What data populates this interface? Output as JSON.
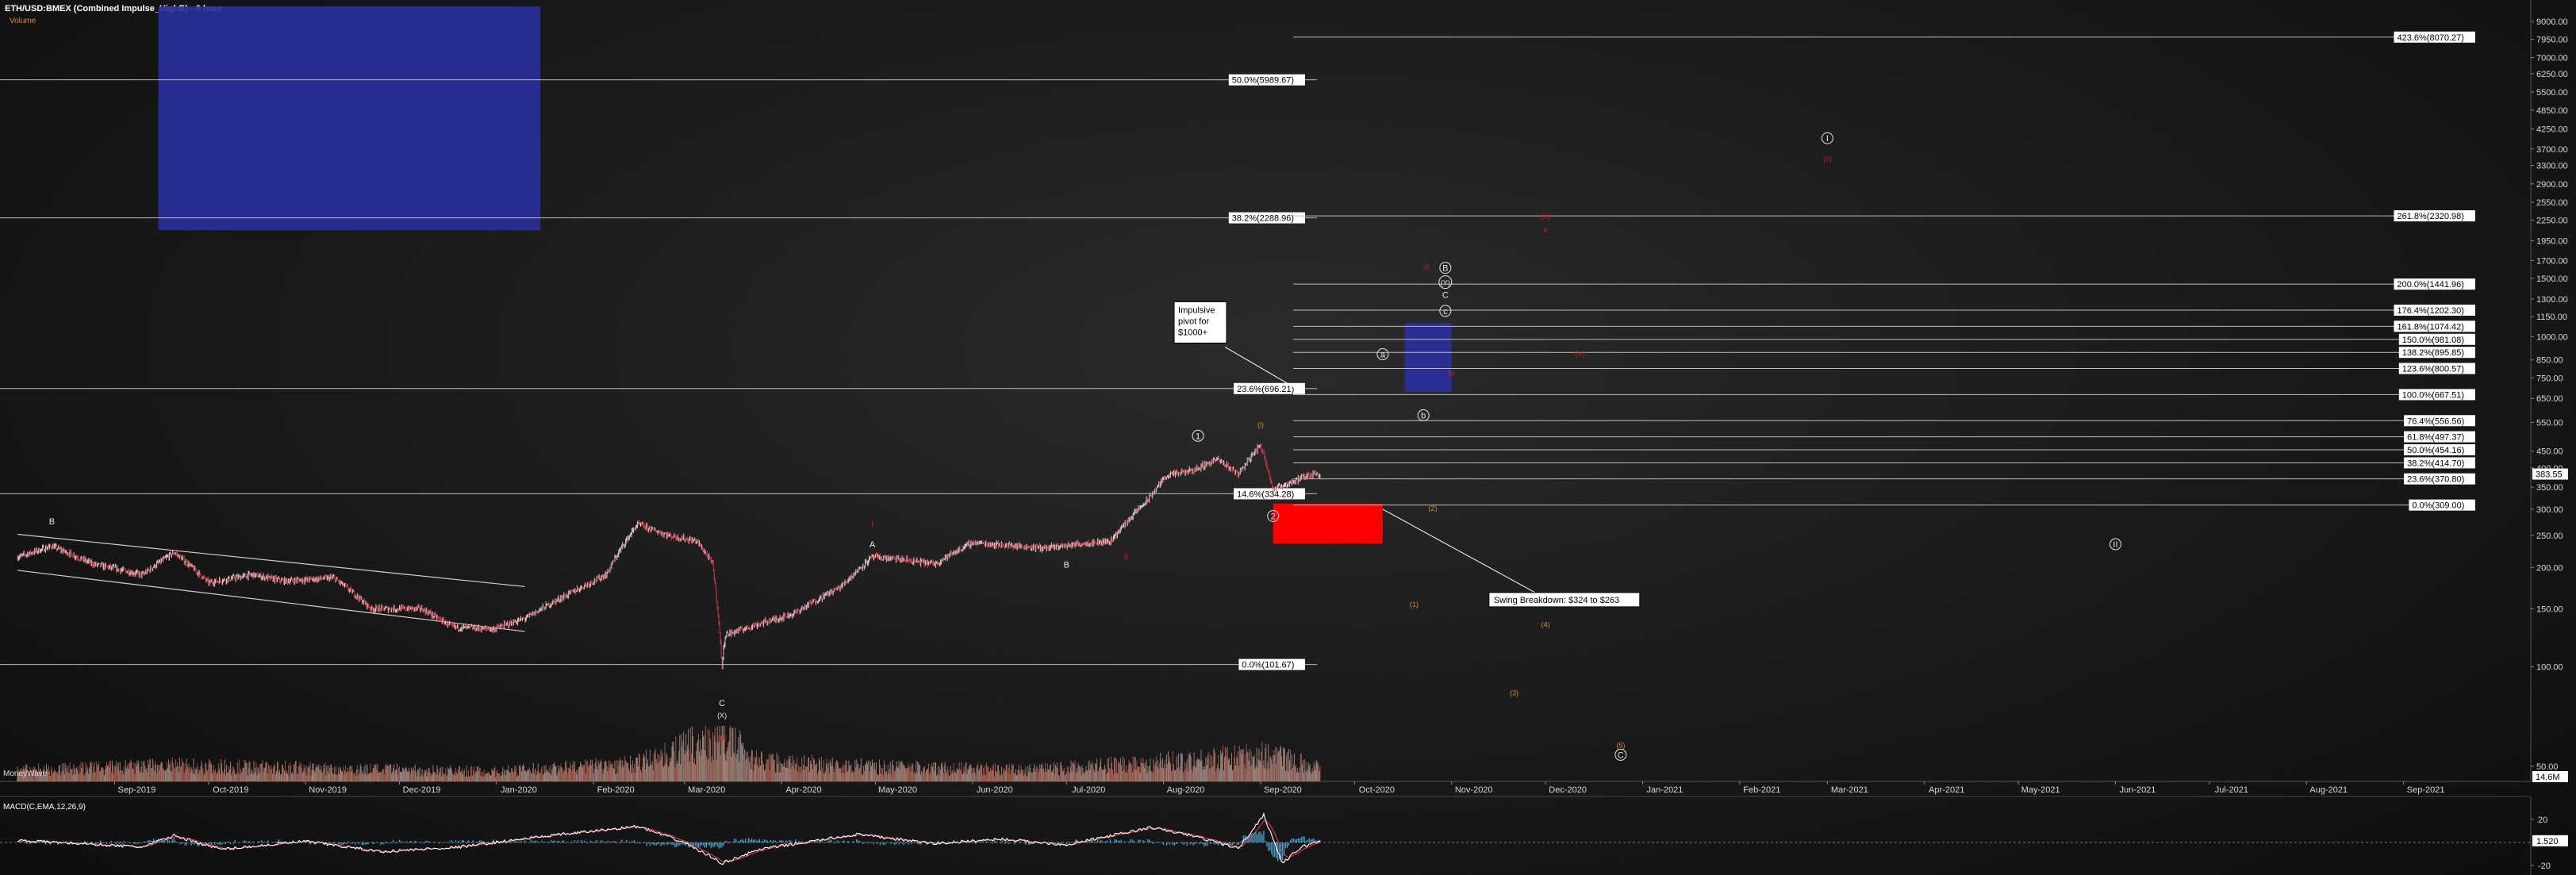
{
  "header": {
    "title": "ETH/USD:BMEX (Combined Impulse_HighB) - 6 hour",
    "subtitle": "Volume"
  },
  "colors": {
    "candle_up": "#d8d8d8",
    "candle_down": "#e0394a",
    "fib_line": "#bdbdbd",
    "blue_box": "#2a2f9c",
    "red_box": "#ff0000",
    "wave_orange": "#e08a1e",
    "wave_red": "#d01c1c",
    "wave_white": "#e6e6e6",
    "macd_line": "#ffffff",
    "signal_line": "#e0394a",
    "hist": "#4aa0c8"
  },
  "panels": {
    "volume_label": "MoneyWave",
    "volume_readout": "14.6M",
    "macd_label": "MACD(C,EMA,12,26,9)",
    "macd_readout": "1.520",
    "macd_ticks": [
      "20",
      "-20"
    ]
  },
  "chart_data": {
    "type": "candlestick",
    "symbol": "ETH/USD:BMEX",
    "scale": "log",
    "ylim": [
      45,
      10000
    ],
    "yticks": [
      "9000.00",
      "7950.00",
      "7000.00",
      "6250.00",
      "5500.00",
      "4850.00",
      "4250.00",
      "3700.00",
      "3300.00",
      "2900.00",
      "2550.00",
      "2250.00",
      "1950.00",
      "1700.00",
      "1500.00",
      "1300.00",
      "1150.00",
      "1000.00",
      "850.00",
      "750.00",
      "650.00",
      "550.00",
      "450.00",
      "400.00",
      "350.00",
      "300.00",
      "250.00",
      "200.00",
      "150.00",
      "100.00",
      "50.00"
    ],
    "xticks": [
      "Sep-2019",
      "Oct-2019",
      "Nov-2019",
      "Dec-2019",
      "Jan-2020",
      "Feb-2020",
      "Mar-2020",
      "Apr-2020",
      "May-2020",
      "Jun-2020",
      "Jul-2020",
      "Aug-2020",
      "Sep-2020",
      "Oct-2020",
      "Nov-2020",
      "Dec-2020",
      "Jan-2021",
      "Feb-2021",
      "Mar-2021",
      "Apr-2021",
      "May-2021",
      "Jun-2021",
      "Jul-2021",
      "Aug-2021",
      "Sep-2021"
    ],
    "last_price": "383.55",
    "price_path": [
      [
        "2019-08-01",
        215
      ],
      [
        "2019-08-12",
        232
      ],
      [
        "2019-08-25",
        205
      ],
      [
        "2019-09-10",
        190
      ],
      [
        "2019-09-20",
        222
      ],
      [
        "2019-10-01",
        180
      ],
      [
        "2019-10-15",
        190
      ],
      [
        "2019-10-25",
        182
      ],
      [
        "2019-11-10",
        186
      ],
      [
        "2019-11-22",
        150
      ],
      [
        "2019-12-08",
        150
      ],
      [
        "2019-12-18",
        132
      ],
      [
        "2019-12-31",
        130
      ],
      [
        "2020-01-10",
        140
      ],
      [
        "2020-01-25",
        168
      ],
      [
        "2020-02-05",
        190
      ],
      [
        "2020-02-15",
        270
      ],
      [
        "2020-02-25",
        250
      ],
      [
        "2020-03-05",
        240
      ],
      [
        "2020-03-10",
        205
      ],
      [
        "2020-03-13",
        100
      ],
      [
        "2020-03-14",
        125
      ],
      [
        "2020-03-25",
        135
      ],
      [
        "2020-04-05",
        145
      ],
      [
        "2020-04-20",
        175
      ],
      [
        "2020-04-30",
        215
      ],
      [
        "2020-05-08",
        212
      ],
      [
        "2020-05-20",
        205
      ],
      [
        "2020-06-01",
        238
      ],
      [
        "2020-06-15",
        232
      ],
      [
        "2020-06-25",
        229
      ],
      [
        "2020-07-05",
        236
      ],
      [
        "2020-07-15",
        240
      ],
      [
        "2020-07-27",
        320
      ],
      [
        "2020-08-02",
        380
      ],
      [
        "2020-08-10",
        392
      ],
      [
        "2020-08-18",
        425
      ],
      [
        "2020-08-25",
        385
      ],
      [
        "2020-09-01",
        470
      ],
      [
        "2020-09-05",
        345
      ],
      [
        "2020-09-10",
        360
      ],
      [
        "2020-09-18",
        385
      ],
      [
        "2020-09-20",
        383
      ]
    ],
    "volume_path": [
      [
        "2019-08-01",
        0.25
      ],
      [
        "2019-09-20",
        0.35
      ],
      [
        "2019-11-10",
        0.28
      ],
      [
        "2019-12-31",
        0.22
      ],
      [
        "2020-02-15",
        0.4
      ],
      [
        "2020-03-13",
        1.0
      ],
      [
        "2020-03-25",
        0.45
      ],
      [
        "2020-05-01",
        0.32
      ],
      [
        "2020-06-20",
        0.25
      ],
      [
        "2020-08-05",
        0.45
      ],
      [
        "2020-09-05",
        0.6
      ],
      [
        "2020-09-20",
        0.3
      ]
    ],
    "macd_path": [
      [
        "2019-08-01",
        2
      ],
      [
        "2019-09-10",
        -4
      ],
      [
        "2019-09-20",
        6
      ],
      [
        "2019-10-05",
        -6
      ],
      [
        "2019-11-01",
        1
      ],
      [
        "2019-11-25",
        -8
      ],
      [
        "2019-12-20",
        -4
      ],
      [
        "2020-01-15",
        5
      ],
      [
        "2020-02-15",
        14
      ],
      [
        "2020-03-01",
        0
      ],
      [
        "2020-03-13",
        -18
      ],
      [
        "2020-03-25",
        -6
      ],
      [
        "2020-04-25",
        7
      ],
      [
        "2020-05-20",
        -1
      ],
      [
        "2020-06-10",
        3
      ],
      [
        "2020-07-01",
        -2
      ],
      [
        "2020-07-28",
        13
      ],
      [
        "2020-08-10",
        6
      ],
      [
        "2020-08-25",
        -5
      ],
      [
        "2020-09-02",
        24
      ],
      [
        "2020-09-08",
        -18
      ],
      [
        "2020-09-14",
        -4
      ],
      [
        "2020-09-20",
        1.5
      ]
    ],
    "fib_levels_left": [
      {
        "label": "50.0%(5989.67)",
        "price": 5989.67
      },
      {
        "label": "38.2%(2288.96)",
        "price": 2288.96
      },
      {
        "label": "23.6%(696.21)",
        "price": 696.21
      },
      {
        "label": "14.6%(334.28)",
        "price": 334.28
      },
      {
        "label": "0.0%(101.67)",
        "price": 101.67
      }
    ],
    "fib_levels_right": [
      {
        "label": "423.6%(8070.27)",
        "price": 8070.27
      },
      {
        "label": "261.8%(2320.98)",
        "price": 2320.98
      },
      {
        "label": "200.0%(1441.96)",
        "price": 1441.96
      },
      {
        "label": "176.4%(1202.30)",
        "price": 1202.3
      },
      {
        "label": "161.8%(1074.42)",
        "price": 1074.42
      },
      {
        "label": "150.0%(981.08)",
        "price": 981.08
      },
      {
        "label": "138.2%(895.85)",
        "price": 895.85
      },
      {
        "label": "123.6%(800.57)",
        "price": 800.57
      },
      {
        "label": "100.0%(667.51)",
        "price": 667.51
      },
      {
        "label": "76.4%(556.56)",
        "price": 556.56
      },
      {
        "label": "61.8%(497.37)",
        "price": 497.37
      },
      {
        "label": "50.0%(454.16)",
        "price": 454.16
      },
      {
        "label": "38.2%(414.70)",
        "price": 414.7
      },
      {
        "label": "23.6%(370.80)",
        "price": 370.8
      },
      {
        "label": "0.0%(309.00)",
        "price": 309.0
      }
    ],
    "target_boxes": [
      {
        "color": "blue",
        "date_from": "2019-09-15",
        "date_to": "2020-01-15",
        "price_from": 2100,
        "price_to": 10000
      },
      {
        "color": "blue",
        "date_from": "2020-10-17",
        "date_to": "2020-11-01",
        "price_from": 680,
        "price_to": 1100
      },
      {
        "color": "red",
        "date_from": "2020-09-05",
        "date_to": "2020-10-10",
        "price_from": 236,
        "price_to": 312
      }
    ],
    "annotations": [
      {
        "text": "Impulsive\npivot for\n$1000+",
        "date": "2020-08-12",
        "price": 1080
      },
      {
        "text": "Swing Breakdown: $324 to $263",
        "date": "2020-11-18",
        "price": 158
      }
    ],
    "wave_labels": [
      {
        "text": "B",
        "date": "2019-08-12",
        "price": 270,
        "color": "white",
        "style": "plain"
      },
      {
        "text": "C",
        "date": "2020-03-13",
        "price": 76,
        "color": "white",
        "style": "plain"
      },
      {
        "text": "(X)",
        "date": "2020-03-13",
        "price": 70,
        "color": "white",
        "style": "plain"
      },
      {
        "text": "(iii)",
        "date": "2020-03-13",
        "price": 60,
        "color": "red",
        "style": "plain"
      },
      {
        "text": "A",
        "date": "2020-04-30",
        "price": 230,
        "color": "white",
        "style": "plain"
      },
      {
        "text": "i",
        "date": "2020-04-30",
        "price": 265,
        "color": "red",
        "style": "plain"
      },
      {
        "text": "B",
        "date": "2020-07-01",
        "price": 200,
        "color": "white",
        "style": "plain"
      },
      {
        "text": "ii",
        "date": "2020-07-20",
        "price": 212,
        "color": "red",
        "style": "plain"
      },
      {
        "text": "1",
        "date": "2020-08-12",
        "price": 490,
        "color": "white",
        "style": "circle"
      },
      {
        "text": "(i)",
        "date": "2020-09-01",
        "price": 532,
        "color": "orange",
        "style": "plain"
      },
      {
        "text": "2",
        "date": "2020-09-05",
        "price": 280,
        "color": "white",
        "style": "circle"
      },
      {
        "text": "(2)",
        "date": "2020-10-26",
        "price": 297,
        "color": "orange",
        "style": "plain"
      },
      {
        "text": "(1)",
        "date": "2020-10-20",
        "price": 152,
        "color": "orange",
        "style": "plain"
      },
      {
        "text": "(4)",
        "date": "2020-12-01",
        "price": 132,
        "color": "orange",
        "style": "plain"
      },
      {
        "text": "(3)",
        "date": "2020-11-21",
        "price": 82,
        "color": "orange",
        "style": "plain"
      },
      {
        "text": "(5)",
        "date": "2020-12-25",
        "price": 57,
        "color": "orange",
        "style": "plain"
      },
      {
        "text": "C",
        "date": "2020-12-25",
        "price": 53,
        "color": "white",
        "style": "circle"
      },
      {
        "text": "a",
        "date": "2020-10-10",
        "price": 865,
        "color": "white",
        "style": "circle"
      },
      {
        "text": "b",
        "date": "2020-10-23",
        "price": 565,
        "color": "white",
        "style": "circle"
      },
      {
        "text": "iii",
        "date": "2020-10-24",
        "price": 1600,
        "color": "red",
        "style": "plain"
      },
      {
        "text": "B",
        "date": "2020-10-30",
        "price": 1580,
        "color": "white",
        "style": "circle"
      },
      {
        "text": "(Y)",
        "date": "2020-10-30",
        "price": 1430,
        "color": "white",
        "style": "circle"
      },
      {
        "text": "C",
        "date": "2020-10-30",
        "price": 1310,
        "color": "white",
        "style": "plain"
      },
      {
        "text": "c",
        "date": "2020-10-30",
        "price": 1170,
        "color": "white",
        "style": "circle"
      },
      {
        "text": "iv",
        "date": "2020-11-01",
        "price": 760,
        "color": "red",
        "style": "plain"
      },
      {
        "text": "(iv)",
        "date": "2020-12-12",
        "price": 875,
        "color": "red",
        "style": "plain"
      },
      {
        "text": "(iii)",
        "date": "2020-12-01",
        "price": 2280,
        "color": "red",
        "style": "plain"
      },
      {
        "text": "v",
        "date": "2020-12-01",
        "price": 2070,
        "color": "red",
        "style": "plain"
      },
      {
        "text": "I",
        "date": "2021-03-01",
        "price": 3900,
        "color": "white",
        "style": "circle"
      },
      {
        "text": "(v)",
        "date": "2021-03-01",
        "price": 3400,
        "color": "red",
        "style": "plain"
      },
      {
        "text": "II",
        "date": "2021-06-01",
        "price": 230,
        "color": "white",
        "style": "circle"
      }
    ],
    "channel": [
      {
        "from": [
          "2019-08-01",
          252
        ],
        "to": [
          "2020-01-10",
          175
        ]
      },
      {
        "from": [
          "2019-08-01",
          196
        ],
        "to": [
          "2020-01-10",
          128
        ]
      }
    ]
  }
}
